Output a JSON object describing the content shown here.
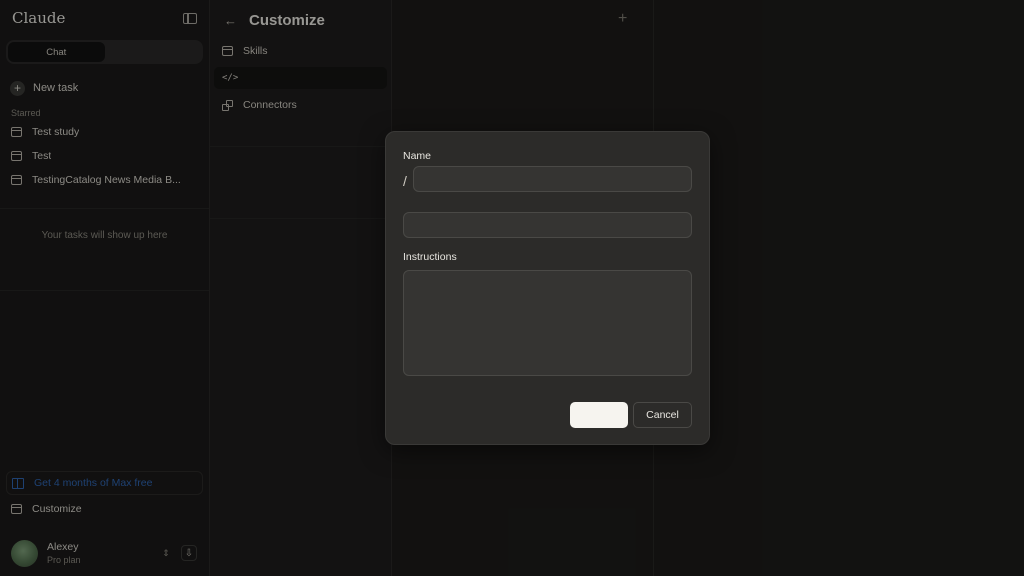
{
  "sidebar": {
    "logo": "Claude",
    "mode_switch": [
      "Chat",
      ""
    ],
    "new_task": "New task",
    "starred_label": "Starred",
    "starred_items": [
      "Test study",
      "Test",
      "TestingCatalog News Media B..."
    ],
    "empty_message": "Your tasks will show up here",
    "promo": "Get 4 months of Max free",
    "customize": "Customize",
    "user": {
      "name": "Alexey",
      "plan": "Pro plan"
    }
  },
  "panel": {
    "back_icon": "arrow-left-icon",
    "title": "Customize",
    "items": [
      {
        "label": "Skills",
        "icon": "toolbox-icon"
      },
      {
        "label": "",
        "icon": "code-icon",
        "active": true
      },
      {
        "label": "Connectors",
        "icon": "connectors-icon"
      }
    ]
  },
  "content": {
    "add_icon": "plus-icon"
  },
  "modal": {
    "name_label": "Name",
    "slash": "/",
    "name_value": "",
    "description_value": "",
    "instructions_label": "Instructions",
    "instructions_value": "",
    "primary_label": "",
    "cancel_label": "Cancel"
  },
  "colors": {
    "background": "#1f1e1d",
    "modal": "#2c2b29",
    "promo_text": "#2f64b0",
    "primary_button": "#f6f4ef"
  }
}
